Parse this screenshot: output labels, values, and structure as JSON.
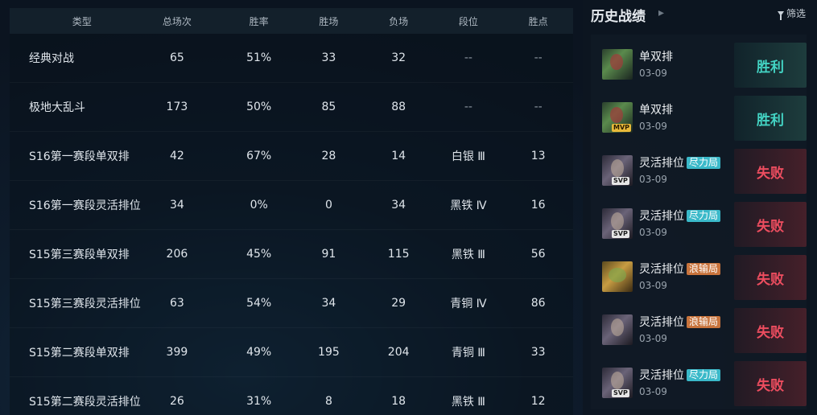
{
  "stats": {
    "headers": {
      "type": "类型",
      "total": "总场次",
      "winrate": "胜率",
      "wins": "胜场",
      "losses": "负场",
      "tier": "段位",
      "lp": "胜点"
    },
    "rows": [
      {
        "type": "经典对战",
        "total": "65",
        "winrate": "51%",
        "wins": "33",
        "losses": "32",
        "tier": "--",
        "lp": "--"
      },
      {
        "type": "极地大乱斗",
        "total": "173",
        "winrate": "50%",
        "wins": "85",
        "losses": "88",
        "tier": "--",
        "lp": "--"
      },
      {
        "type": "S16第一赛段单双排",
        "total": "42",
        "winrate": "67%",
        "wins": "28",
        "losses": "14",
        "tier": "白银 Ⅲ",
        "lp": "13"
      },
      {
        "type": "S16第一赛段灵活排位",
        "total": "34",
        "winrate": "0%",
        "wins": "0",
        "losses": "34",
        "tier": "黑铁 Ⅳ",
        "lp": "16"
      },
      {
        "type": "S15第三赛段单双排",
        "total": "206",
        "winrate": "45%",
        "wins": "91",
        "losses": "115",
        "tier": "黑铁 Ⅲ",
        "lp": "56"
      },
      {
        "type": "S15第三赛段灵活排位",
        "total": "63",
        "winrate": "54%",
        "wins": "34",
        "losses": "29",
        "tier": "青铜 Ⅳ",
        "lp": "86"
      },
      {
        "type": "S15第二赛段单双排",
        "total": "399",
        "winrate": "49%",
        "wins": "195",
        "losses": "204",
        "tier": "青铜 Ⅲ",
        "lp": "33"
      },
      {
        "type": "S15第二赛段灵活排位",
        "total": "26",
        "winrate": "31%",
        "wins": "8",
        "losses": "18",
        "tier": "黑铁 Ⅲ",
        "lp": "12"
      }
    ]
  },
  "history": {
    "title": "历史战绩",
    "filter_label": "筛选",
    "arrow_icon": "chevron-right-icon",
    "filter_icon": "filter-icon",
    "colors": {
      "win": "#43d3c3",
      "lose": "#ec4d5f"
    },
    "matches": [
      {
        "mode": "单双排",
        "tag": "",
        "date": "03-09",
        "result": "胜利",
        "badge": "",
        "champion_icon": "champion-portrait-a"
      },
      {
        "mode": "单双排",
        "tag": "",
        "date": "03-09",
        "result": "胜利",
        "badge": "MVP",
        "champion_icon": "champion-portrait-a"
      },
      {
        "mode": "灵活排位",
        "tag": "尽力局",
        "date": "03-09",
        "result": "失败",
        "badge": "SVP",
        "champion_icon": "champion-portrait-b"
      },
      {
        "mode": "灵活排位",
        "tag": "尽力局",
        "date": "03-09",
        "result": "失败",
        "badge": "SVP",
        "champion_icon": "champion-portrait-b"
      },
      {
        "mode": "灵活排位",
        "tag": "浪输局",
        "date": "03-09",
        "result": "失败",
        "badge": "",
        "champion_icon": "champion-portrait-c"
      },
      {
        "mode": "灵活排位",
        "tag": "浪输局",
        "date": "03-09",
        "result": "失败",
        "badge": "",
        "champion_icon": "champion-portrait-b"
      },
      {
        "mode": "灵活排位",
        "tag": "尽力局",
        "date": "03-09",
        "result": "失败",
        "badge": "SVP",
        "champion_icon": "champion-portrait-b"
      }
    ]
  }
}
